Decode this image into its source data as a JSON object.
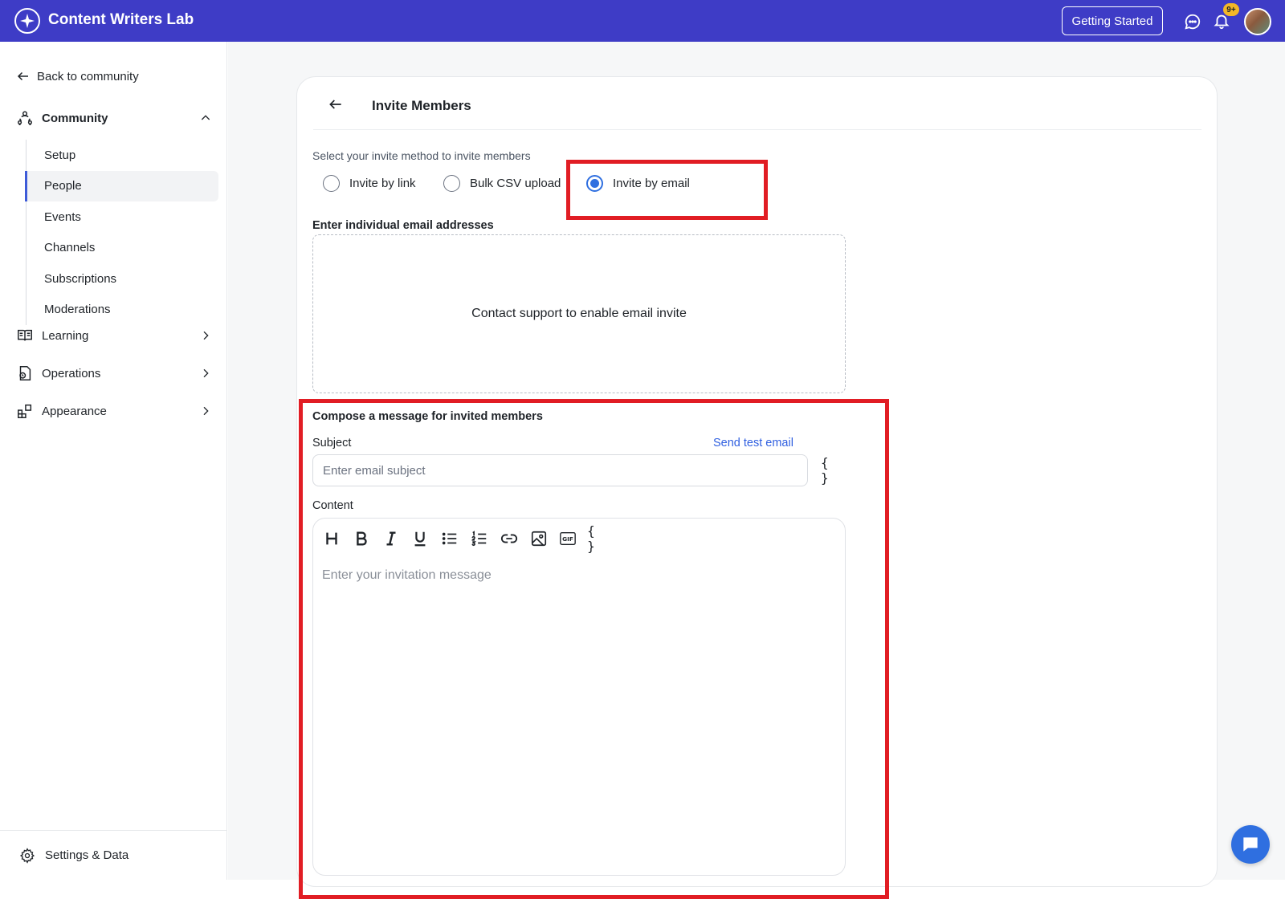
{
  "topbar": {
    "brand_name": "Content Writers Lab",
    "getting_started_label": "Getting Started",
    "notification_badge": "9+",
    "accent_color": "#3e3cc6"
  },
  "sidebar": {
    "back_label": "Back to community",
    "sections": [
      {
        "label": "Community",
        "icon": "community-icon",
        "expanded": true
      },
      {
        "label": "Learning",
        "icon": "book-icon",
        "expanded": false
      },
      {
        "label": "Operations",
        "icon": "operations-icon",
        "expanded": false
      },
      {
        "label": "Appearance",
        "icon": "appearance-icon",
        "expanded": false
      }
    ],
    "community_items": [
      "Setup",
      "People",
      "Events",
      "Channels",
      "Subscriptions",
      "Moderations"
    ],
    "active_item": "People",
    "footer_label": "Settings & Data"
  },
  "invite": {
    "title": "Invite Members",
    "method_prompt": "Select your invite method to invite members",
    "methods": [
      {
        "label": "Invite by link",
        "selected": false
      },
      {
        "label": "Bulk CSV upload",
        "selected": false
      },
      {
        "label": "Invite by email",
        "selected": true
      }
    ],
    "email_section_label": "Enter individual email addresses",
    "email_box_message": "Contact support to enable email invite",
    "compose_label": "Compose a message for invited members",
    "subject_label": "Subject",
    "send_test_label": "Send test email",
    "subject_placeholder": "Enter email subject",
    "subject_value": "",
    "variables_label": "{ }",
    "content_label": "Content",
    "content_placeholder": "Enter your invitation message",
    "toolbar": [
      "heading-icon",
      "bold-icon",
      "italic-icon",
      "underline-icon",
      "bullet-list-icon",
      "numbered-list-icon",
      "link-icon",
      "image-icon",
      "gif-icon",
      "variables-icon"
    ]
  },
  "colors": {
    "link": "#2f5fe0",
    "radio_selected": "#2f6fe0",
    "highlight": "#e11d24"
  }
}
